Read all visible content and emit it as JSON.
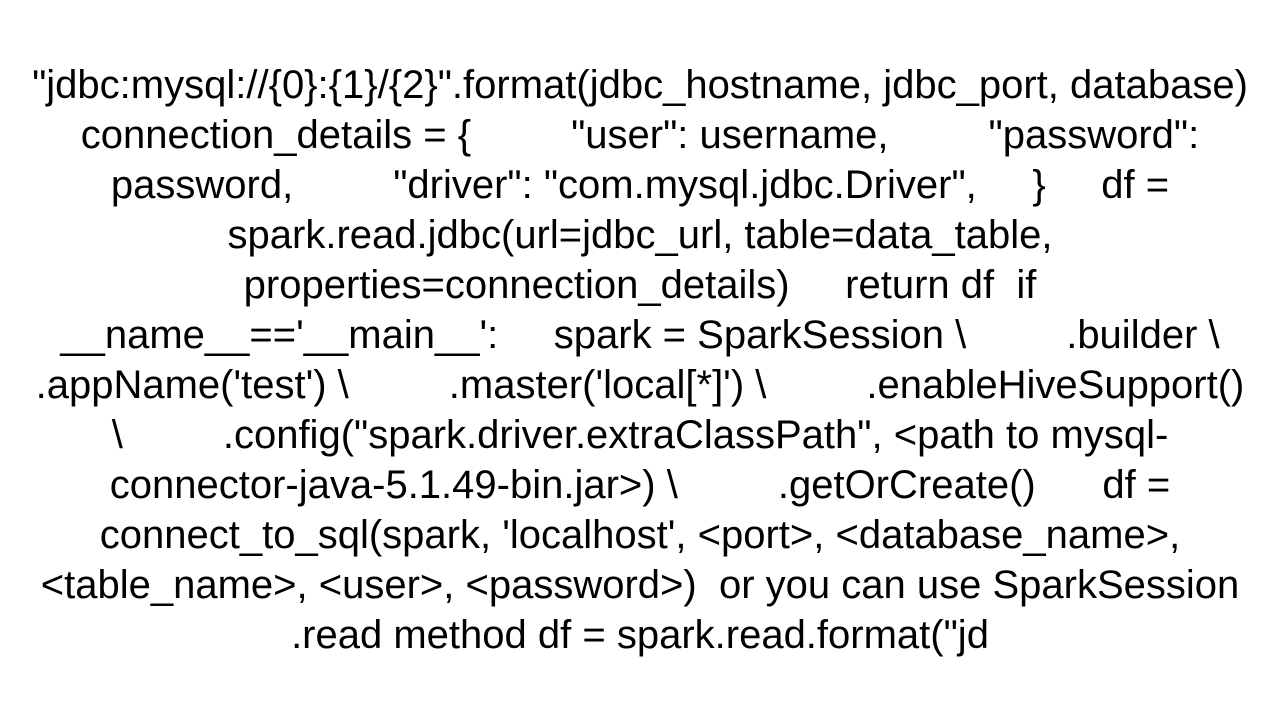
{
  "code_snippet": "\"jdbc:mysql://{0}:{1}/{2}\".format(jdbc_hostname, jdbc_port, database)     connection_details = {         \"user\": username,         \"password\": password,         \"driver\": \"com.mysql.jdbc.Driver\",     }     df = spark.read.jdbc(url=jdbc_url, table=data_table, properties=connection_details)     return df  if __name__=='__main__':     spark = SparkSession \\         .builder \\         .appName('test') \\         .master('local[*]') \\         .enableHiveSupport() \\         .config(\"spark.driver.extraClassPath\", <path to mysql-connector-java-5.1.49-bin.jar>) \\         .getOrCreate()      df = connect_to_sql(spark, 'localhost', <port>, <database_name>, <table_name>, <user>, <password>)  or you can use SparkSession .read method df = spark.read.format(\"jd"
}
